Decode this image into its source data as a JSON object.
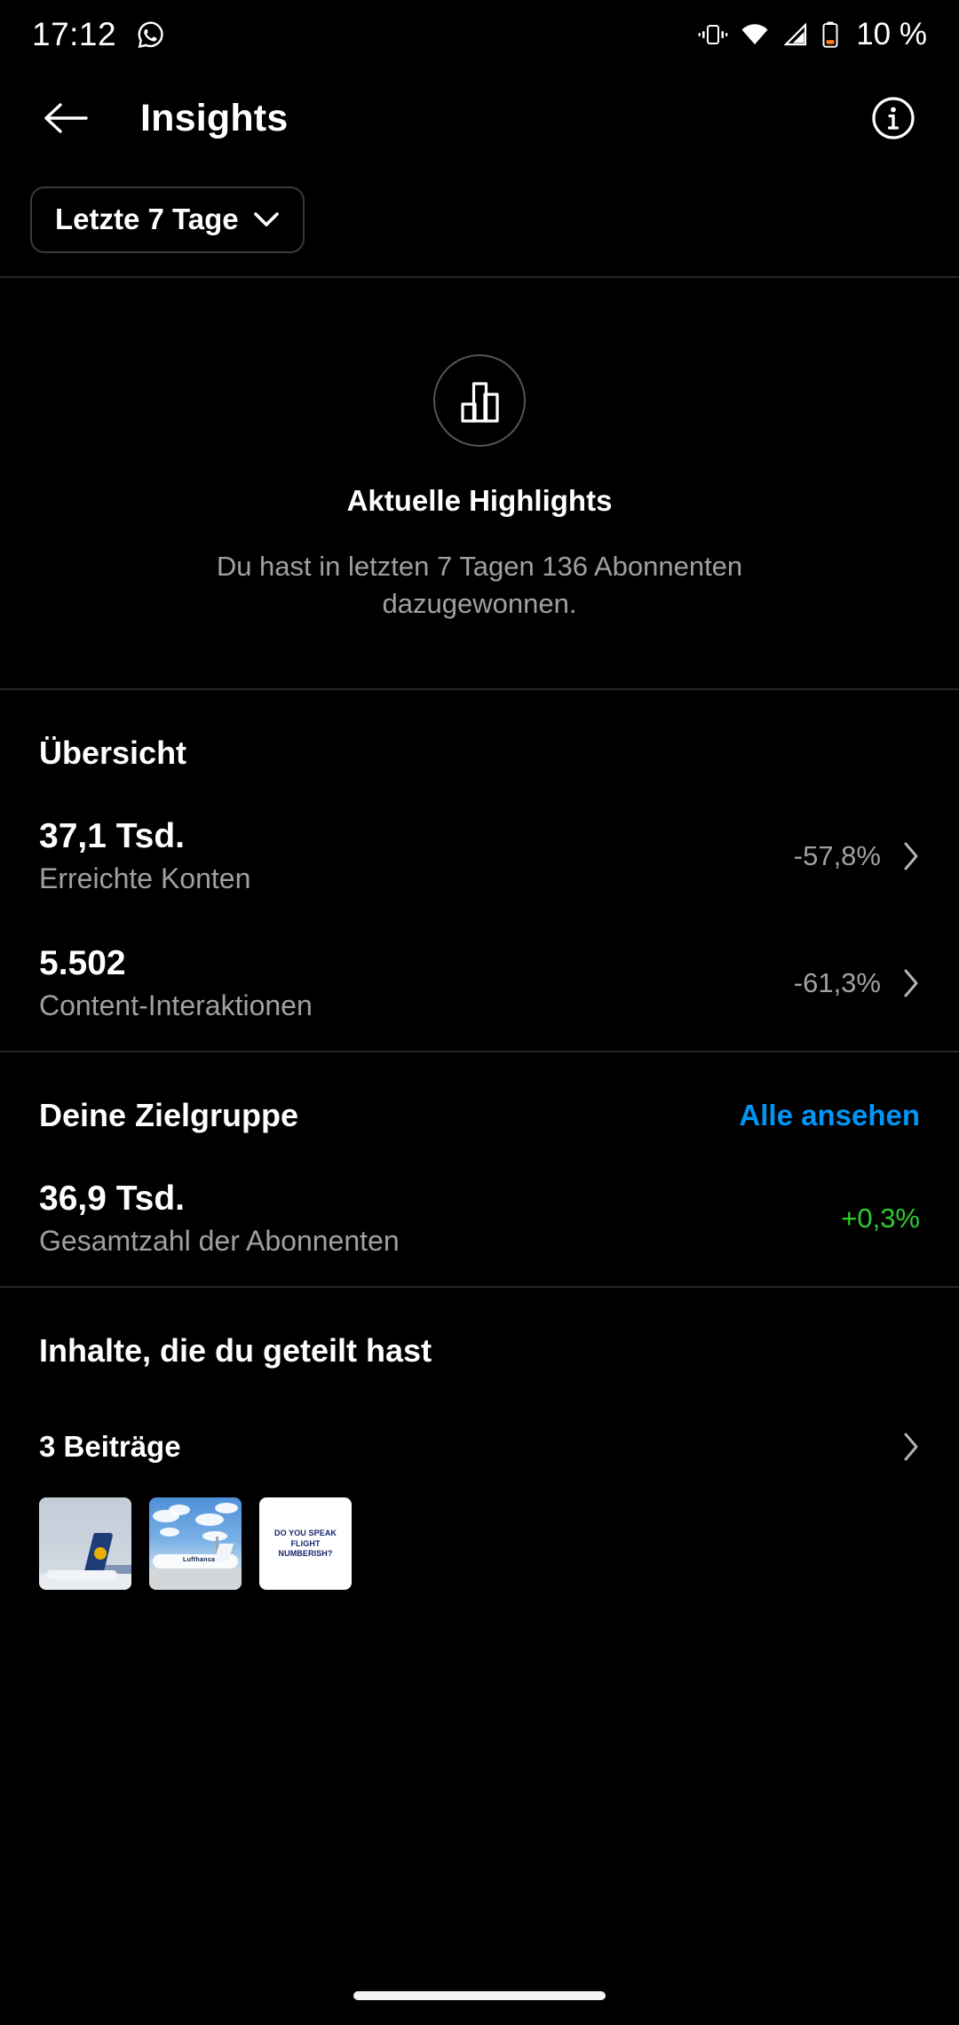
{
  "status_bar": {
    "time": "17:12",
    "battery_text": "10 %",
    "icons": [
      "whatsapp-icon",
      "vibrate-icon",
      "wifi-icon",
      "cellular-signal-icon",
      "battery-icon"
    ]
  },
  "header": {
    "title": "Insights",
    "back_icon": "back-arrow-icon",
    "info_icon": "info-circle-icon"
  },
  "filter": {
    "label": "Letzte 7 Tage",
    "chevron_icon": "chevron-down-icon"
  },
  "highlights": {
    "icon": "bar-chart-icon",
    "title": "Aktuelle Highlights",
    "description": "Du hast in letzten 7 Tagen 136 Abonnenten dazugewonnen."
  },
  "overview": {
    "title": "Übersicht",
    "metrics": [
      {
        "value": "37,1 Tsd.",
        "label": "Erreichte Konten",
        "delta": "-57,8%",
        "delta_sign": "negative",
        "chevron": true
      },
      {
        "value": "5.502",
        "label": "Content-Interaktionen",
        "delta": "-61,3%",
        "delta_sign": "negative",
        "chevron": true
      }
    ]
  },
  "audience": {
    "title": "Deine Zielgruppe",
    "action_label": "Alle ansehen",
    "metrics": [
      {
        "value": "36,9 Tsd.",
        "label": "Gesamtzahl der Abonnenten",
        "delta": "+0,3%",
        "delta_sign": "positive",
        "chevron": false
      }
    ]
  },
  "shared_content": {
    "title": "Inhalte, die du geteilt hast",
    "posts_count": "3 Beiträge",
    "chevron_icon": "chevron-right-icon",
    "thumbnails": [
      {
        "alt": "lufthansa-aircraft-tail-photo",
        "caption": ""
      },
      {
        "alt": "lufthansa-aircraft-apron-photo",
        "caption": "Lufthansa"
      },
      {
        "alt": "flight-numberish-text-card",
        "caption": "DO YOU SPEAK FLIGHT NUMBERISH?"
      }
    ]
  },
  "colors": {
    "background": "#000000",
    "accent_blue": "#0095F6",
    "positive_green": "#2ECC2E",
    "muted_text": "#A0A0A0",
    "divider": "#262626"
  }
}
